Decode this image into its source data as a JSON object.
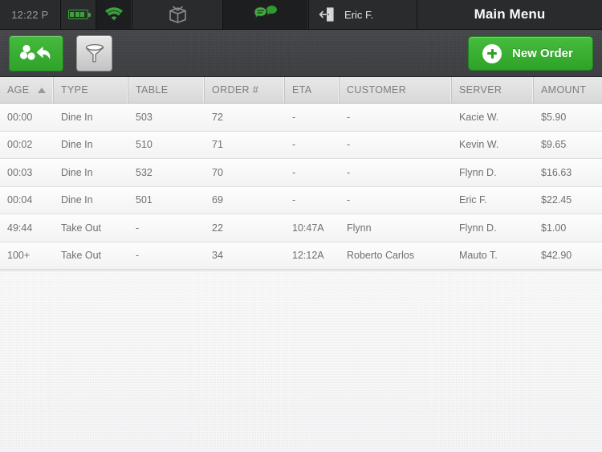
{
  "statusbar": {
    "time": "12:22 P",
    "battery_icon": "battery-icon",
    "wifi_icon": "wifi-icon",
    "takeout_box_icon": "takeout-box-icon",
    "chat_icon": "chat-bubbles-icon",
    "logout_icon": "logout-door-icon",
    "user_name": "Eric F.",
    "title": "Main Menu",
    "accent_green": "#3f9f3f"
  },
  "toolbar": {
    "back_button_icon": "orders-back-icon",
    "filter_button_icon": "funnel-filter-icon",
    "new_order_label": "New Order",
    "new_order_icon": "plus-circle-icon",
    "accent_green": "#2da228"
  },
  "table": {
    "columns": [
      {
        "key": "age",
        "label": "AGE",
        "sorted": true,
        "sort_dir": "asc"
      },
      {
        "key": "type",
        "label": "TYPE",
        "sorted": false
      },
      {
        "key": "table",
        "label": "TABLE",
        "sorted": false
      },
      {
        "key": "order",
        "label": "ORDER #",
        "sorted": false
      },
      {
        "key": "eta",
        "label": "ETA",
        "sorted": false
      },
      {
        "key": "customer",
        "label": "CUSTOMER",
        "sorted": false
      },
      {
        "key": "server",
        "label": "SERVER",
        "sorted": false
      },
      {
        "key": "amount",
        "label": "AMOUNT",
        "sorted": false
      }
    ],
    "rows": [
      {
        "age": "00:00",
        "type": "Dine In",
        "table": "503",
        "order": "72",
        "eta": "-",
        "customer": "-",
        "server": "Kacie W.",
        "amount": "$5.90"
      },
      {
        "age": "00:02",
        "type": "Dine In",
        "table": "510",
        "order": "71",
        "eta": "-",
        "customer": "-",
        "server": "Kevin W.",
        "amount": "$9.65"
      },
      {
        "age": "00:03",
        "type": "Dine In",
        "table": "532",
        "order": "70",
        "eta": "-",
        "customer": "-",
        "server": "Flynn D.",
        "amount": "$16.63"
      },
      {
        "age": "00:04",
        "type": "Dine In",
        "table": "501",
        "order": "69",
        "eta": "-",
        "customer": "-",
        "server": "Eric F.",
        "amount": "$22.45"
      },
      {
        "age": "49:44",
        "type": "Take Out",
        "table": "-",
        "order": "22",
        "eta": "10:47A",
        "customer": "Flynn",
        "server": "Flynn D.",
        "amount": "$1.00"
      },
      {
        "age": "100+",
        "type": "Take Out",
        "table": "-",
        "order": "34",
        "eta": "12:12A",
        "customer": "Roberto Carlos",
        "server": "Mauto T.",
        "amount": "$42.90"
      }
    ]
  }
}
